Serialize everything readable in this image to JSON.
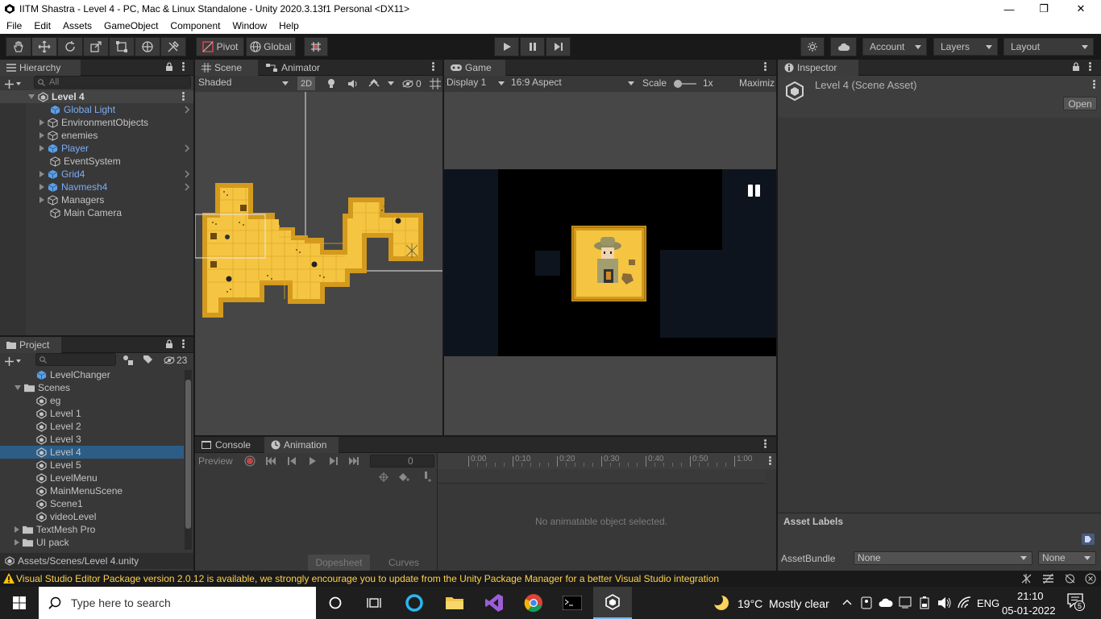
{
  "window": {
    "title": "IITM Shastra - Level 4 - PC, Mac & Linux Standalone - Unity 2020.3.13f1 Personal <DX11>",
    "minimize": "—",
    "restore": "❐",
    "close": "✕"
  },
  "menu": [
    "File",
    "Edit",
    "Assets",
    "GameObject",
    "Component",
    "Window",
    "Help"
  ],
  "toolbar": {
    "pivot_label": "Pivot",
    "global_label": "Global",
    "account_label": "Account",
    "layers_label": "Layers",
    "layout_label": "Layout"
  },
  "hierarchy": {
    "tab": "Hierarchy",
    "search_placeholder": "All",
    "scene": "Level 4",
    "items": [
      {
        "label": "Global Light",
        "prefab": true,
        "expandable": false
      },
      {
        "label": "EnvironmentObjects",
        "prefab": false,
        "expandable": true
      },
      {
        "label": "enemies",
        "prefab": false,
        "expandable": true
      },
      {
        "label": "Player",
        "prefab": true,
        "expandable": true
      },
      {
        "label": "EventSystem",
        "prefab": false,
        "expandable": false
      },
      {
        "label": "Grid4",
        "prefab": true,
        "expandable": true
      },
      {
        "label": "Navmesh4",
        "prefab": true,
        "expandable": true
      },
      {
        "label": "Managers",
        "prefab": false,
        "expandable": true
      },
      {
        "label": "Main Camera",
        "prefab": false,
        "expandable": false
      }
    ]
  },
  "scene": {
    "tab": "Scene",
    "tab2": "Animator",
    "shading": "Shaded",
    "mode2d": "2D",
    "hidden_count": "0"
  },
  "game": {
    "tab": "Game",
    "display": "Display 1",
    "aspect": "16:9 Aspect",
    "scale_label": "Scale",
    "scale_value": "1x",
    "maximize": "Maximiz"
  },
  "inspector": {
    "tab": "Inspector",
    "asset_title": "Level 4 (Scene Asset)",
    "open_button": "Open",
    "asset_labels": "Asset Labels",
    "assetbundle_label": "AssetBundle",
    "assetbundle_value": "None",
    "variant_value": "None"
  },
  "project": {
    "tab": "Project",
    "hidden_count": "23",
    "path": "Assets/Scenes/Level 4.unity",
    "items": [
      {
        "label": "LevelChanger",
        "type": "prefab",
        "indent": 2
      },
      {
        "label": "Scenes",
        "type": "folder-open",
        "indent": 1
      },
      {
        "label": "eg",
        "type": "scene",
        "indent": 2
      },
      {
        "label": "Level 1",
        "type": "scene",
        "indent": 2
      },
      {
        "label": "Level 2",
        "type": "scene",
        "indent": 2
      },
      {
        "label": "Level 3",
        "type": "scene",
        "indent": 2
      },
      {
        "label": "Level 4",
        "type": "scene",
        "indent": 2,
        "selected": true
      },
      {
        "label": "Level 5",
        "type": "scene",
        "indent": 2
      },
      {
        "label": "LevelMenu",
        "type": "scene",
        "indent": 2
      },
      {
        "label": "MainMenuScene",
        "type": "scene",
        "indent": 2
      },
      {
        "label": "Scene1",
        "type": "scene",
        "indent": 2
      },
      {
        "label": "videoLevel",
        "type": "scene",
        "indent": 2
      },
      {
        "label": "TextMesh Pro",
        "type": "folder",
        "indent": 1
      },
      {
        "label": "UI pack",
        "type": "folder",
        "indent": 1
      }
    ]
  },
  "animation": {
    "tab_console": "Console",
    "tab_animation": "Animation",
    "preview": "Preview",
    "frame": "0",
    "ticks": [
      "0:00",
      "0:10",
      "0:20",
      "0:30",
      "0:40",
      "0:50",
      "1:00"
    ],
    "empty_message": "No animatable object selected.",
    "dopesheet": "Dopesheet",
    "curves": "Curves"
  },
  "status": {
    "message": "Visual Studio Editor Package version 2.0.12 is available, we strongly encourage you to update from the Unity Package Manager for a better Visual Studio integration"
  },
  "taskbar": {
    "search_placeholder": "Type here to search",
    "weather": "19°C  Mostly clear",
    "language": "ENG",
    "time": "21:10",
    "date": "05-01-2022",
    "notification_count": "5"
  },
  "colors": {
    "selection": "#2c5d87",
    "prefab_blue": "#7bacf5",
    "tile_yellow": "#f5c542",
    "tile_border": "#d39a1d",
    "warning": "#ffd24d"
  }
}
